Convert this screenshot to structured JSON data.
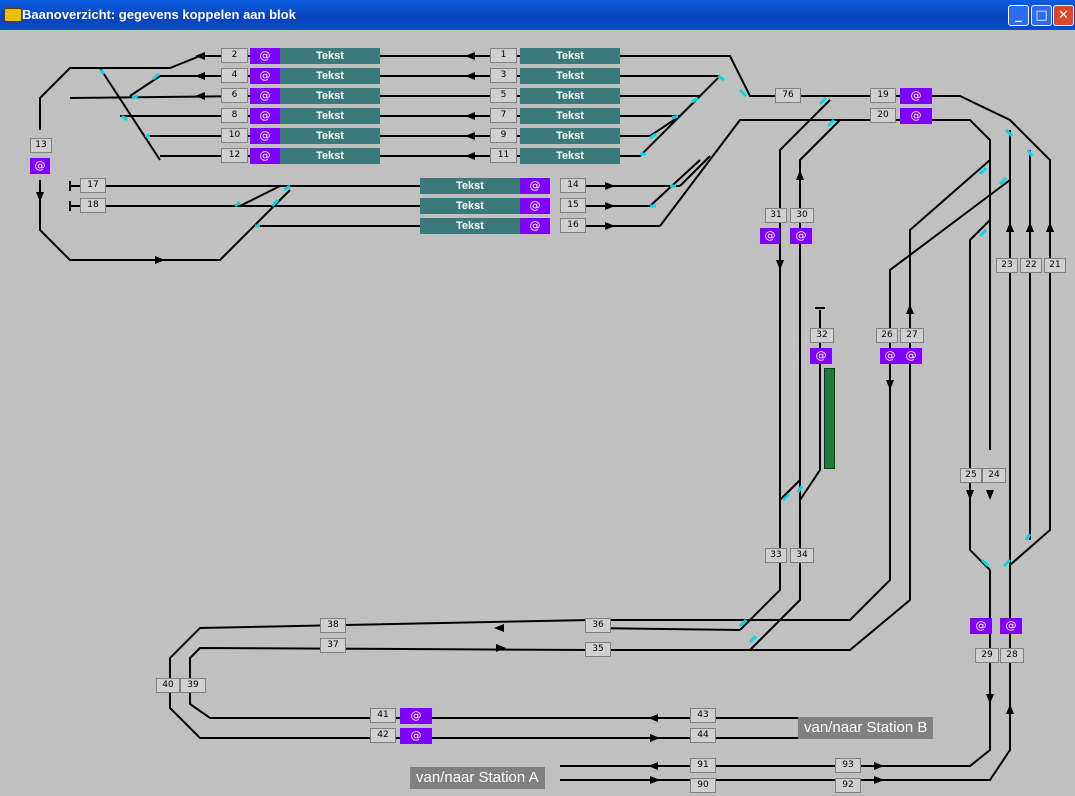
{
  "window": {
    "title": "Baanoverzicht: gegevens koppelen aan blok"
  },
  "controls": {
    "minimize": "_",
    "maximize": "□",
    "close": "✕"
  },
  "common": {
    "tekst": "Tekst",
    "at": "@"
  },
  "stations": {
    "b": "van/naar Station B",
    "a": "van/naar Station A"
  },
  "blocks": {
    "b1": "1",
    "b2": "2",
    "b3": "3",
    "b4": "4",
    "b5": "5",
    "b6": "6",
    "b7": "7",
    "b8": "8",
    "b9": "9",
    "b10": "10",
    "b11": "11",
    "b12": "12",
    "b13": "13",
    "b14": "14",
    "b15": "15",
    "b16": "16",
    "b17": "17",
    "b18": "18",
    "b19": "19",
    "b20": "20",
    "b21": "21",
    "b22": "22",
    "b23": "23",
    "b24": "24",
    "b25": "25",
    "b26": "26",
    "b27": "27",
    "b28": "28",
    "b29": "29",
    "b30": "30",
    "b31": "31",
    "b32": "32",
    "b33": "33",
    "b34": "34",
    "b35": "35",
    "b36": "36",
    "b37": "37",
    "b38": "38",
    "b39": "39",
    "b40": "40",
    "b41": "41",
    "b42": "42",
    "b43": "43",
    "b44": "44",
    "b76": "76",
    "b90": "90",
    "b91": "91",
    "b92": "92",
    "b93": "93"
  }
}
